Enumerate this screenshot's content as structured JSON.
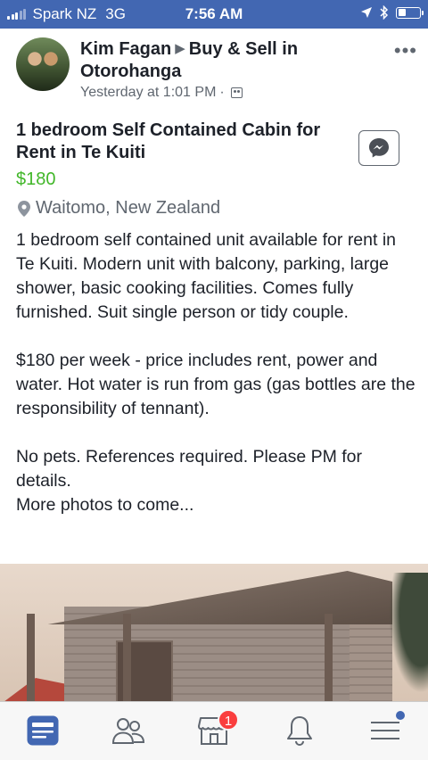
{
  "status_bar": {
    "carrier": "Spark NZ",
    "network": "3G",
    "time": "7:56 AM",
    "battery_level": 0.35
  },
  "post": {
    "author": "Kim Fagan",
    "group": "Buy & Sell in Otorohanga",
    "timestamp": "Yesterday at 1:01 PM",
    "separator": "·",
    "more_label": "•••"
  },
  "listing": {
    "title": "1 bedroom Self Contained Cabin for Rent in Te Kuiti",
    "price": "$180",
    "location": "Waitomo, New Zealand",
    "description": [
      "1 bedroom self contained unit available for rent in Te Kuiti.  Modern unit with balcony, parking, large shower, basic cooking facilities.  Comes fully furnished.  Suit single person or tidy couple.",
      "$180 per week - price includes rent, power and water.  Hot water is run from gas (gas bottles are the responsibility of tennant).",
      "No pets.  References required. Please PM for details.",
      "More photos to come..."
    ]
  },
  "tabbar": {
    "items": [
      {
        "icon": "news-feed-icon",
        "active": true
      },
      {
        "icon": "friends-icon",
        "active": false
      },
      {
        "icon": "marketplace-icon",
        "active": false,
        "badge": "1"
      },
      {
        "icon": "notifications-icon",
        "active": false
      },
      {
        "icon": "menu-icon",
        "active": false
      }
    ]
  },
  "colors": {
    "brand": "#4267b2",
    "price": "#42b72a",
    "badge": "#fa3e3e"
  }
}
